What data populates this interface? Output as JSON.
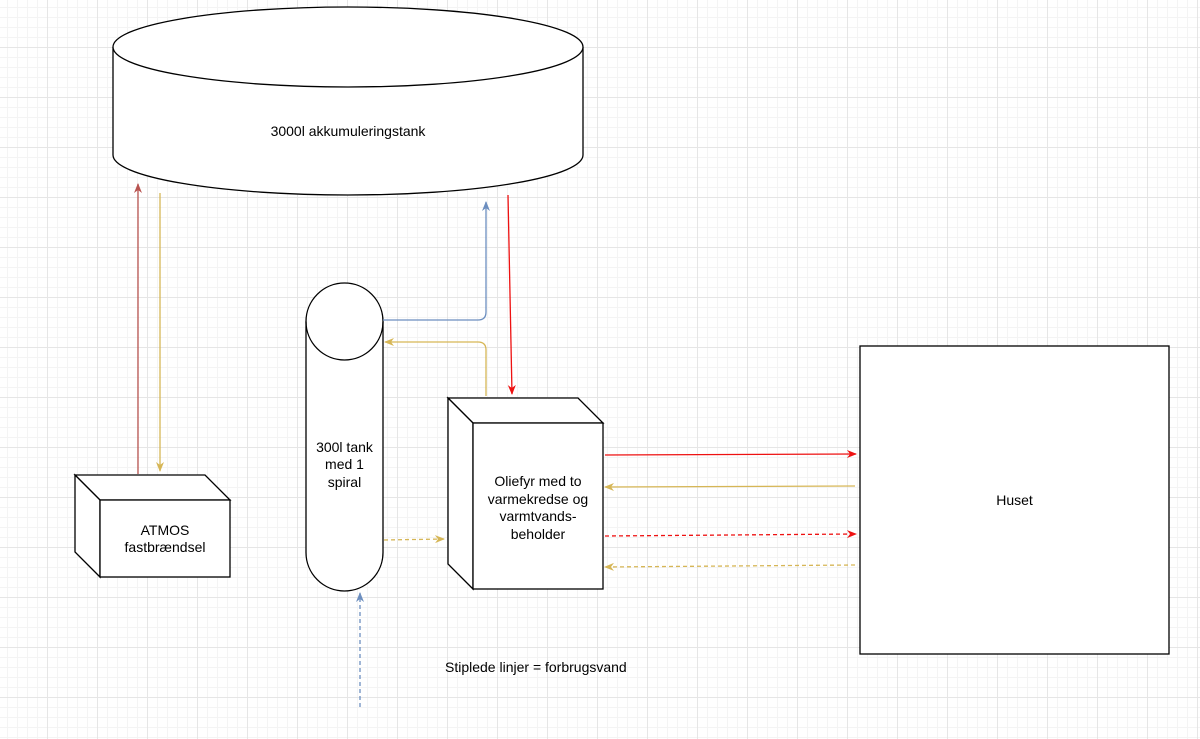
{
  "nodes": {
    "accumulation_tank": {
      "label": "3000l akkumuleringstank"
    },
    "tank_300": {
      "label": "300l tank\nmed 1\nspiral"
    },
    "atmos": {
      "label": "ATMOS\nfastbrændsel"
    },
    "oil_boiler": {
      "label": "Oliefyr med to\nvarmekredse og\nvarmtvands-\nbeholder"
    },
    "house": {
      "label": "Huset"
    }
  },
  "legend": {
    "text": "Stiplede linjer = forbrugsvand"
  },
  "colors": {
    "red": "#ee1111",
    "dark_red": "#b85450",
    "yellow": "#d6b656",
    "blue": "#6c8ebf",
    "stroke": "#000000"
  }
}
